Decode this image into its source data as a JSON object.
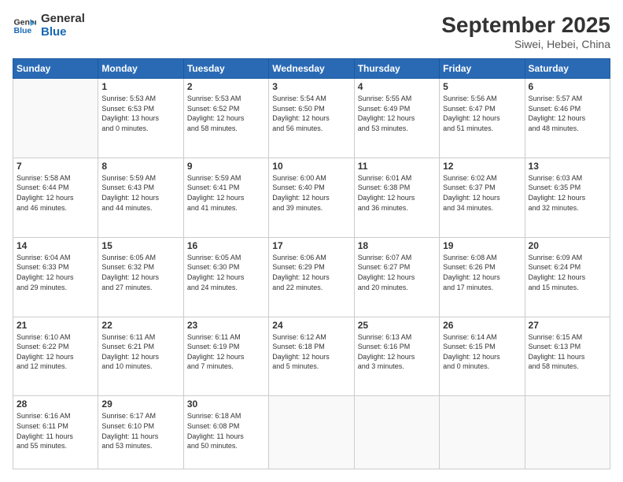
{
  "logo": {
    "line1": "General",
    "line2": "Blue"
  },
  "header": {
    "month": "September 2025",
    "location": "Siwei, Hebei, China"
  },
  "weekdays": [
    "Sunday",
    "Monday",
    "Tuesday",
    "Wednesday",
    "Thursday",
    "Friday",
    "Saturday"
  ],
  "weeks": [
    [
      {
        "day": "",
        "info": ""
      },
      {
        "day": "1",
        "info": "Sunrise: 5:53 AM\nSunset: 6:53 PM\nDaylight: 13 hours\nand 0 minutes."
      },
      {
        "day": "2",
        "info": "Sunrise: 5:53 AM\nSunset: 6:52 PM\nDaylight: 12 hours\nand 58 minutes."
      },
      {
        "day": "3",
        "info": "Sunrise: 5:54 AM\nSunset: 6:50 PM\nDaylight: 12 hours\nand 56 minutes."
      },
      {
        "day": "4",
        "info": "Sunrise: 5:55 AM\nSunset: 6:49 PM\nDaylight: 12 hours\nand 53 minutes."
      },
      {
        "day": "5",
        "info": "Sunrise: 5:56 AM\nSunset: 6:47 PM\nDaylight: 12 hours\nand 51 minutes."
      },
      {
        "day": "6",
        "info": "Sunrise: 5:57 AM\nSunset: 6:46 PM\nDaylight: 12 hours\nand 48 minutes."
      }
    ],
    [
      {
        "day": "7",
        "info": "Sunrise: 5:58 AM\nSunset: 6:44 PM\nDaylight: 12 hours\nand 46 minutes."
      },
      {
        "day": "8",
        "info": "Sunrise: 5:59 AM\nSunset: 6:43 PM\nDaylight: 12 hours\nand 44 minutes."
      },
      {
        "day": "9",
        "info": "Sunrise: 5:59 AM\nSunset: 6:41 PM\nDaylight: 12 hours\nand 41 minutes."
      },
      {
        "day": "10",
        "info": "Sunrise: 6:00 AM\nSunset: 6:40 PM\nDaylight: 12 hours\nand 39 minutes."
      },
      {
        "day": "11",
        "info": "Sunrise: 6:01 AM\nSunset: 6:38 PM\nDaylight: 12 hours\nand 36 minutes."
      },
      {
        "day": "12",
        "info": "Sunrise: 6:02 AM\nSunset: 6:37 PM\nDaylight: 12 hours\nand 34 minutes."
      },
      {
        "day": "13",
        "info": "Sunrise: 6:03 AM\nSunset: 6:35 PM\nDaylight: 12 hours\nand 32 minutes."
      }
    ],
    [
      {
        "day": "14",
        "info": "Sunrise: 6:04 AM\nSunset: 6:33 PM\nDaylight: 12 hours\nand 29 minutes."
      },
      {
        "day": "15",
        "info": "Sunrise: 6:05 AM\nSunset: 6:32 PM\nDaylight: 12 hours\nand 27 minutes."
      },
      {
        "day": "16",
        "info": "Sunrise: 6:05 AM\nSunset: 6:30 PM\nDaylight: 12 hours\nand 24 minutes."
      },
      {
        "day": "17",
        "info": "Sunrise: 6:06 AM\nSunset: 6:29 PM\nDaylight: 12 hours\nand 22 minutes."
      },
      {
        "day": "18",
        "info": "Sunrise: 6:07 AM\nSunset: 6:27 PM\nDaylight: 12 hours\nand 20 minutes."
      },
      {
        "day": "19",
        "info": "Sunrise: 6:08 AM\nSunset: 6:26 PM\nDaylight: 12 hours\nand 17 minutes."
      },
      {
        "day": "20",
        "info": "Sunrise: 6:09 AM\nSunset: 6:24 PM\nDaylight: 12 hours\nand 15 minutes."
      }
    ],
    [
      {
        "day": "21",
        "info": "Sunrise: 6:10 AM\nSunset: 6:22 PM\nDaylight: 12 hours\nand 12 minutes."
      },
      {
        "day": "22",
        "info": "Sunrise: 6:11 AM\nSunset: 6:21 PM\nDaylight: 12 hours\nand 10 minutes."
      },
      {
        "day": "23",
        "info": "Sunrise: 6:11 AM\nSunset: 6:19 PM\nDaylight: 12 hours\nand 7 minutes."
      },
      {
        "day": "24",
        "info": "Sunrise: 6:12 AM\nSunset: 6:18 PM\nDaylight: 12 hours\nand 5 minutes."
      },
      {
        "day": "25",
        "info": "Sunrise: 6:13 AM\nSunset: 6:16 PM\nDaylight: 12 hours\nand 3 minutes."
      },
      {
        "day": "26",
        "info": "Sunrise: 6:14 AM\nSunset: 6:15 PM\nDaylight: 12 hours\nand 0 minutes."
      },
      {
        "day": "27",
        "info": "Sunrise: 6:15 AM\nSunset: 6:13 PM\nDaylight: 11 hours\nand 58 minutes."
      }
    ],
    [
      {
        "day": "28",
        "info": "Sunrise: 6:16 AM\nSunset: 6:11 PM\nDaylight: 11 hours\nand 55 minutes."
      },
      {
        "day": "29",
        "info": "Sunrise: 6:17 AM\nSunset: 6:10 PM\nDaylight: 11 hours\nand 53 minutes."
      },
      {
        "day": "30",
        "info": "Sunrise: 6:18 AM\nSunset: 6:08 PM\nDaylight: 11 hours\nand 50 minutes."
      },
      {
        "day": "",
        "info": ""
      },
      {
        "day": "",
        "info": ""
      },
      {
        "day": "",
        "info": ""
      },
      {
        "day": "",
        "info": ""
      }
    ]
  ]
}
